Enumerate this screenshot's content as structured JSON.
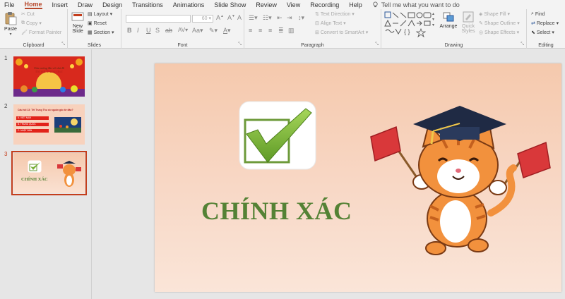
{
  "menu": {
    "tabs": [
      "File",
      "Home",
      "Insert",
      "Draw",
      "Design",
      "Transitions",
      "Animations",
      "Slide Show",
      "Review",
      "View",
      "Recording",
      "Help"
    ],
    "active_tab": "Home",
    "tell_me": "Tell me what you want to do"
  },
  "ribbon": {
    "clipboard": {
      "label": "Clipboard",
      "paste": "Paste",
      "cut": "Cut",
      "copy": "Copy",
      "format_painter": "Format Painter"
    },
    "slides": {
      "label": "Slides",
      "new_slide": "New Slide",
      "layout": "Layout",
      "reset": "Reset",
      "section": "Section"
    },
    "font": {
      "label": "Font",
      "size": "60"
    },
    "paragraph": {
      "label": "Paragraph",
      "text_direction": "Text Direction",
      "align_text": "Align Text",
      "convert_smartart": "Convert to SmartArt"
    },
    "drawing": {
      "label": "Drawing",
      "arrange": "Arrange",
      "quick_styles": "Quick Styles",
      "shape_fill": "Shape Fill",
      "shape_outline": "Shape Outline",
      "shape_effects": "Shape Effects"
    },
    "editing": {
      "label": "Editing",
      "find": "Find",
      "replace": "Replace",
      "select": "Select"
    }
  },
  "thumbnails": [
    {
      "number": "1",
      "line1": "Chúc mừng đến với chủ đề",
      "line2": "Đố vui Trung thu!"
    },
    {
      "number": "2",
      "question": "Câu hỏi 13: Tết Trung Thu có nguồn gốc từ đâu?",
      "options": [
        "A. VIỆT NAM",
        "B. TRUNG QUỐC",
        "C. NHẬT BẢN"
      ]
    },
    {
      "number": "3",
      "title": "CHÍNH XÁC"
    }
  ],
  "slide": {
    "title": "CHÍNH XÁC"
  },
  "colors": {
    "accent": "#b7472a",
    "title_green": "#548235",
    "check_green": "#7bb13c"
  }
}
